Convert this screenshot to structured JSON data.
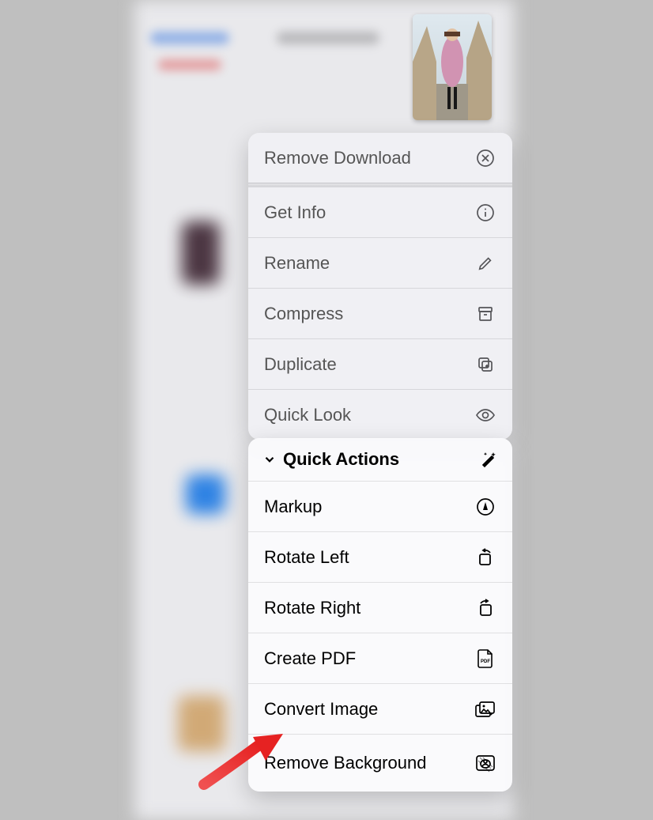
{
  "thumbnail": {
    "alt": "photo-thumbnail"
  },
  "menu1": {
    "remove_download": "Remove Download",
    "get_info": "Get Info",
    "rename": "Rename",
    "compress": "Compress",
    "duplicate": "Duplicate",
    "quick_look": "Quick Look"
  },
  "menu2": {
    "header": "Quick Actions",
    "markup": "Markup",
    "rotate_left": "Rotate Left",
    "rotate_right": "Rotate Right",
    "create_pdf": "Create PDF",
    "convert_image": "Convert Image",
    "remove_background": "Remove Background"
  },
  "annotation": {
    "arrow": "points to Remove Background"
  }
}
